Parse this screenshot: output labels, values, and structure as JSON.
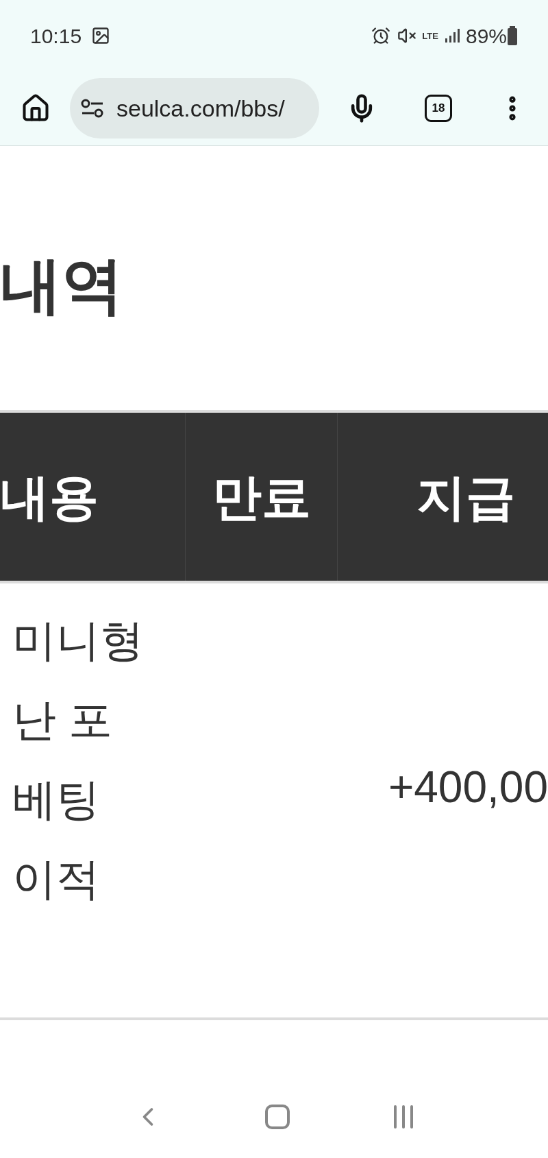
{
  "status_bar": {
    "time": "10:15",
    "battery": "89%",
    "network": "LTE"
  },
  "browser": {
    "url": "seulca.com/bbs/",
    "tab_count": "18"
  },
  "page": {
    "title": "내역"
  },
  "table": {
    "columns": [
      "내용",
      "만료",
      "지급"
    ],
    "rows": [
      {
        "content_lines": [
          "미니형",
          "난 포",
          "베팅",
          "이적"
        ],
        "amount": "+400,00"
      }
    ]
  }
}
